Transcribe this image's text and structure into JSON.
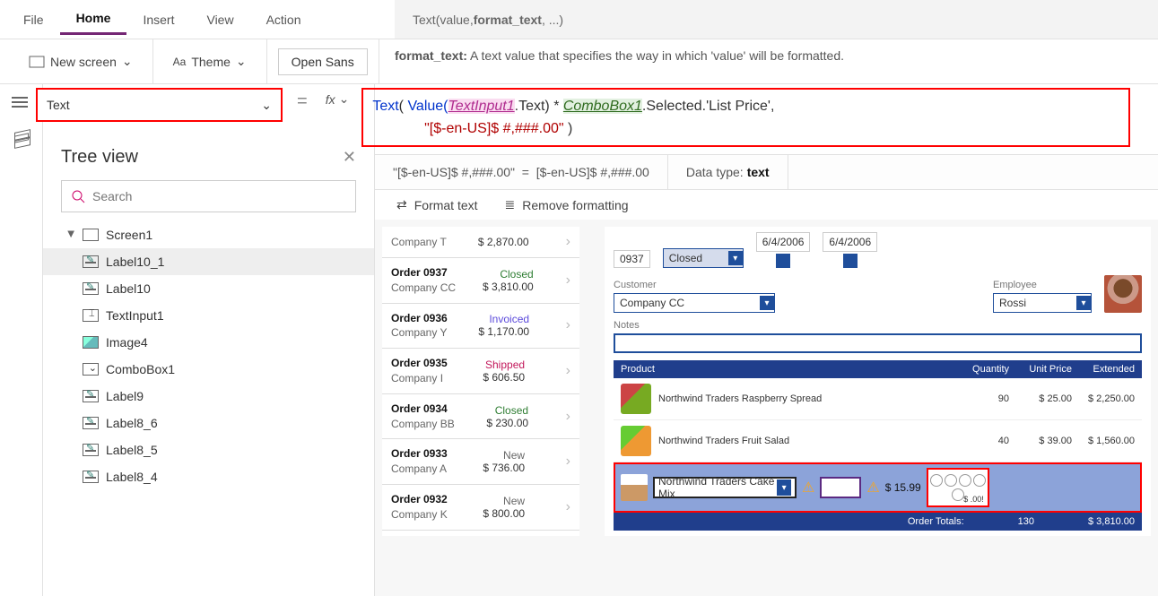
{
  "menu": {
    "file": "File",
    "home": "Home",
    "insert": "Insert",
    "view": "View",
    "action": "Action"
  },
  "ribbon": {
    "newscreen": "New screen",
    "theme": "Theme",
    "font": "Open Sans"
  },
  "signature": {
    "func": "Text",
    "args": "(value, ",
    "bold": "format_text",
    "rest": ", ...)"
  },
  "sighelp": {
    "label": "format_text:",
    "text": " A text value that specifies the way in which 'value' will be formatted."
  },
  "prop": "Text",
  "formula": {
    "fn": "Text",
    "open": "( ",
    "val": "Value(",
    "ti": "TextInput1",
    "tiTail": ".Text) * ",
    "cb": "ComboBox1",
    "cbTail": ".Selected.'List Price',",
    "str": "\"[$-en-US]$ #,###.00\"",
    "close": " )"
  },
  "result": {
    "lhs": "\"[$-en-US]$ #,###.00\"",
    "rhs": "[$-en-US]$ #,###.00",
    "dtlabel": "Data type: ",
    "dt": "text"
  },
  "fmt": {
    "format": "Format text",
    "remove": "Remove formatting"
  },
  "tree": {
    "title": "Tree view",
    "search": "Search",
    "root": "Screen1",
    "nodes": [
      "Label10_1",
      "Label10",
      "TextInput1",
      "Image4",
      "ComboBox1",
      "Label9",
      "Label8_6",
      "Label8_5",
      "Label8_4"
    ],
    "types": [
      "label",
      "label",
      "input",
      "image",
      "combo",
      "label",
      "label",
      "label",
      "label"
    ],
    "selected": 0
  },
  "orders": [
    {
      "id": "",
      "company": "Company T",
      "status": "",
      "price": "$ 2,870.00"
    },
    {
      "id": "Order 0937",
      "company": "Company CC",
      "status": "Closed",
      "price": "$ 3,810.00"
    },
    {
      "id": "Order 0936",
      "company": "Company Y",
      "status": "Invoiced",
      "price": "$ 1,170.00"
    },
    {
      "id": "Order 0935",
      "company": "Company I",
      "status": "Shipped",
      "price": "$ 606.50"
    },
    {
      "id": "Order 0934",
      "company": "Company BB",
      "status": "Closed",
      "price": "$ 230.00"
    },
    {
      "id": "Order 0933",
      "company": "Company A",
      "status": "New",
      "price": "$ 736.00"
    },
    {
      "id": "Order 0932",
      "company": "Company K",
      "status": "New",
      "price": "$ 800.00"
    }
  ],
  "form": {
    "orderNum": "0937",
    "statusLabel": "Closed",
    "date1": "6/4/2006",
    "date2": "6/4/2006",
    "custLabel": "Customer",
    "cust": "Company CC",
    "empLabel": "Employee",
    "emp": "Rossi",
    "notesLabel": "Notes",
    "hdr": {
      "p": "Product",
      "q": "Quantity",
      "u": "Unit Price",
      "e": "Extended"
    },
    "rows": [
      {
        "name": "Northwind Traders Raspberry Spread",
        "q": "90",
        "u": "$ 25.00",
        "e": "$ 2,250.00"
      },
      {
        "name": "Northwind Traders Fruit Salad",
        "q": "40",
        "u": "$ 39.00",
        "e": "$ 1,560.00"
      }
    ],
    "edit": {
      "name": "Northwind Traders Cake Mix",
      "price": "$ 15.99",
      "err": "$ .00!"
    },
    "totals": {
      "label": "Order Totals:",
      "q": "130",
      "amt": "$ 3,810.00"
    }
  }
}
